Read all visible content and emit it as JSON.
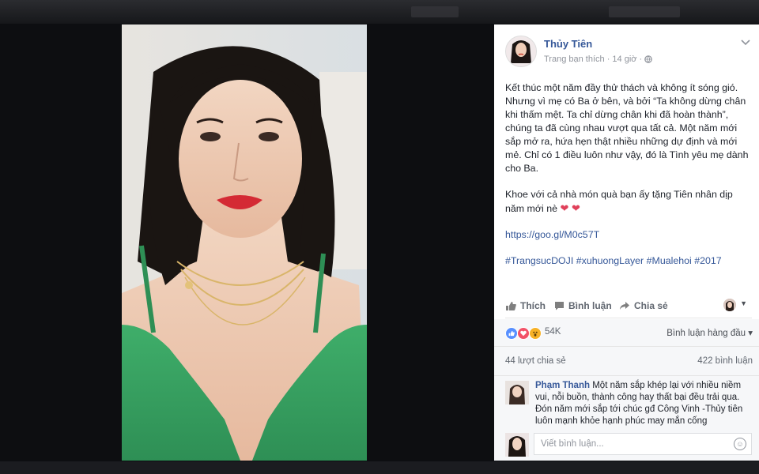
{
  "post": {
    "author": "Thủy Tiên",
    "meta": "Trang bạn thích · 14 giờ ·",
    "paragraphs": [
      "Kết thúc một năm đầy thử thách và không ít sóng gió. Nhưng vì mẹ có Ba ở bên, và bởi “Ta không dừng chân khi thấm mệt. Ta chỉ dừng chân khi đã hoàn thành”, chúng ta đã cùng nhau vượt qua tất cả. Một năm mới sắp mở ra, hứa hẹn thật nhiều những dự định và mới mẻ. Chỉ có 1 điều luôn như vậy, đó là Tình yêu mẹ dành cho Ba.",
      "Khoe với cả nhà món quà bạn ấy tặng Tiên nhân dịp năm mới nè"
    ],
    "hearts": "❤ ❤",
    "link": "https://goo.gl/M0c57T",
    "hashtags": "#TrangsucDOJI #xuhuongLayer #Mualehoi #2017"
  },
  "actions": {
    "like": "Thích",
    "comment": "Bình luận",
    "share": "Chia sẻ"
  },
  "reactions": {
    "count": "54K",
    "sort": "Bình luận hàng đầu ▾"
  },
  "stats": {
    "shares": "44 lượt chia sẻ",
    "comments": "422 bình luận"
  },
  "comment": {
    "name": "Phạm Thanh",
    "text": "Một năm sắp khép lại với nhiều niềm vui, nỗi buồn, thành công hay thất bại đều trải qua. Đón năm mới sắp tới chúc gđ Công Vinh -Thủy tiên luôn mạnh khỏe hạnh phúc may mắn cống"
  },
  "composer": {
    "placeholder": "Viết bình luận..."
  },
  "colors": {
    "link": "#365899",
    "like_blue": "#5890ff",
    "love_red": "#f25268",
    "wow_yellow": "#f7b125"
  },
  "icons": [
    "chevron-down-icon",
    "globe-icon",
    "like-icon",
    "comment-icon",
    "share-icon",
    "emoji-icon"
  ]
}
